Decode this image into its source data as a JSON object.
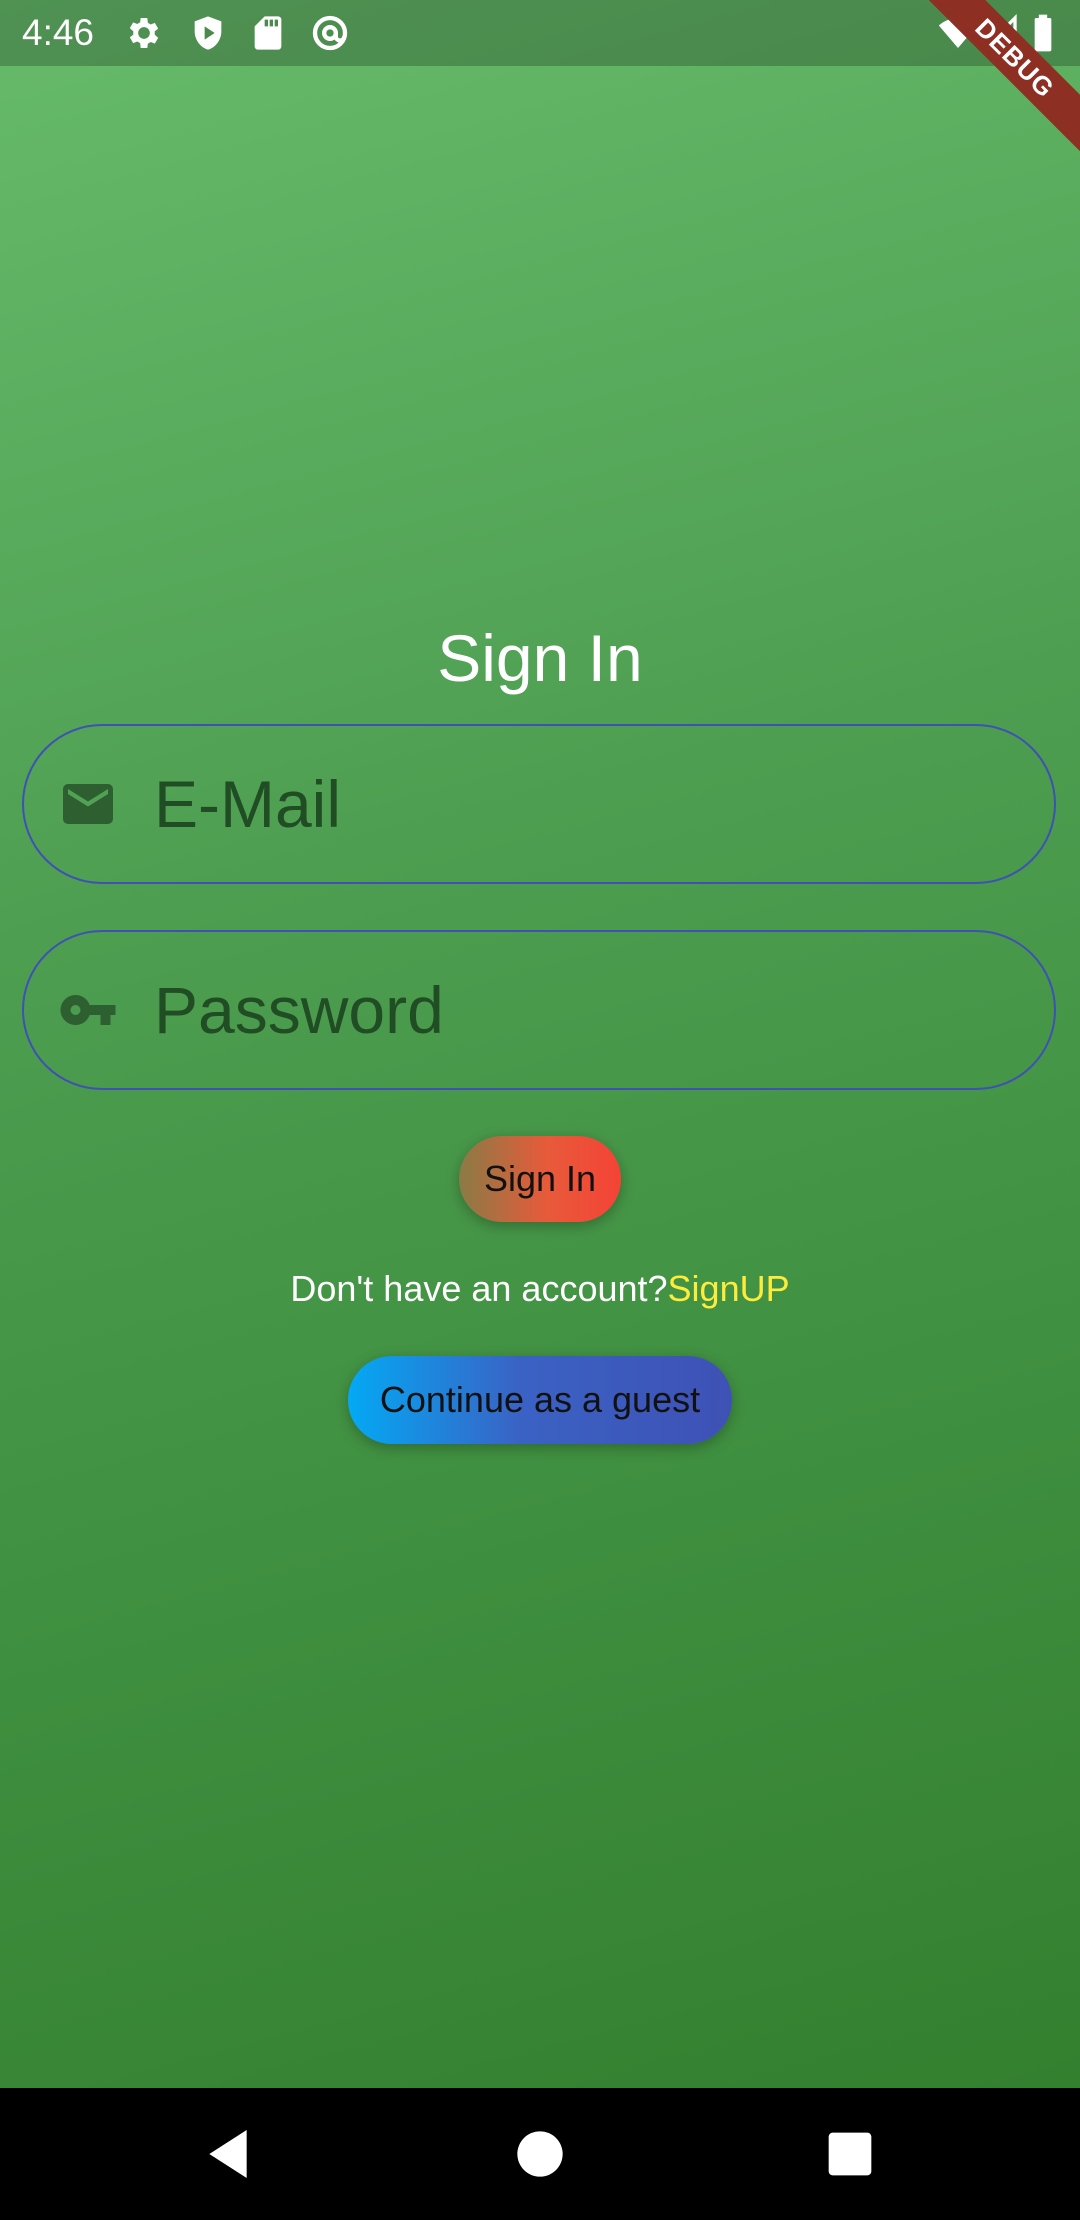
{
  "status_bar": {
    "time": "4:46",
    "left_icons": [
      "gear-icon",
      "shield-play-icon",
      "sd-card-icon",
      "at-sign-icon"
    ],
    "right_icons": [
      "wifi-icon",
      "cell-signal-icon",
      "battery-icon"
    ]
  },
  "debug_banner": "DEBUG",
  "form": {
    "title": "Sign In",
    "email": {
      "placeholder": "E-Mail",
      "value": "",
      "icon": "mail-icon"
    },
    "password": {
      "placeholder": "Password",
      "value": "",
      "icon": "key-icon"
    },
    "signin_label": "Sign In",
    "signup_prompt": "Don't have an account?",
    "signup_link": "SignUP",
    "guest_label": "Continue as a guest"
  },
  "colors": {
    "background_top": "#66bb6a",
    "background_bottom": "#33802f",
    "field_border": "#3f51b5",
    "signin_gradient_end": "#f44336",
    "guest_gradient_start": "#03a9f4",
    "guest_gradient_end": "#3f51b5",
    "signup_link": "#ffeb3b"
  },
  "nav_bar": {
    "buttons": [
      "back-icon",
      "home-icon",
      "recents-icon"
    ]
  }
}
